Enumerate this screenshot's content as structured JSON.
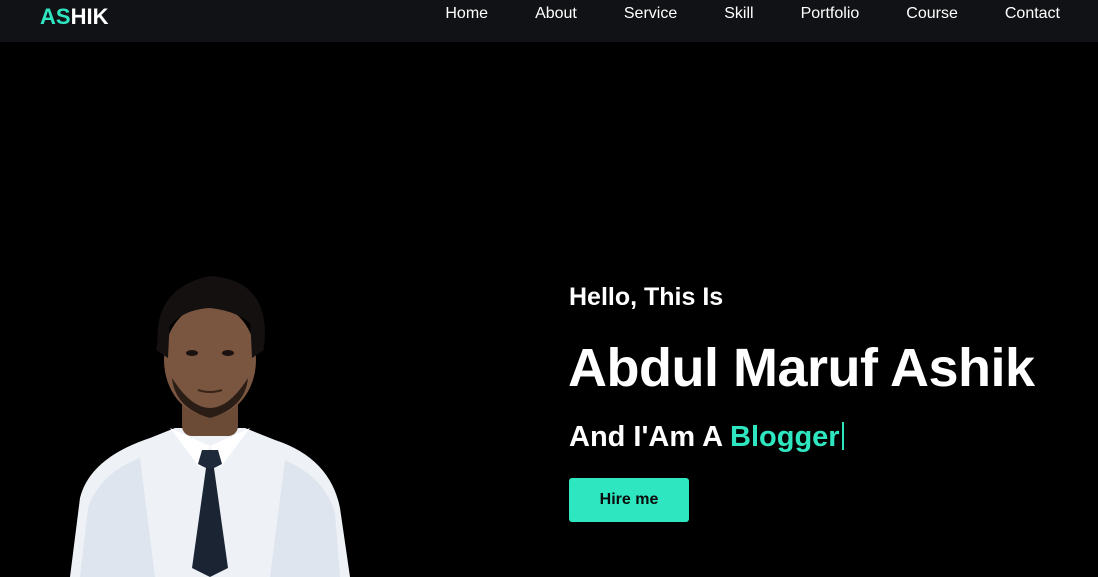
{
  "logo": {
    "accent": "AS",
    "rest": "HIK"
  },
  "nav": [
    {
      "label": "Home"
    },
    {
      "label": "About"
    },
    {
      "label": "Service"
    },
    {
      "label": "Skill"
    },
    {
      "label": "Portfolio"
    },
    {
      "label": "Course"
    },
    {
      "label": "Contact"
    }
  ],
  "hero": {
    "greeting": "Hello, This Is",
    "name": "Abdul Maruf Ashik",
    "role_prefix": "And I'Am A ",
    "role": "Blogger",
    "hire_label": "Hire me",
    "portrait_icon": "person-portrait"
  },
  "colors": {
    "accent": "#2ee6c0",
    "background": "#000000",
    "navbar": "#111215"
  }
}
